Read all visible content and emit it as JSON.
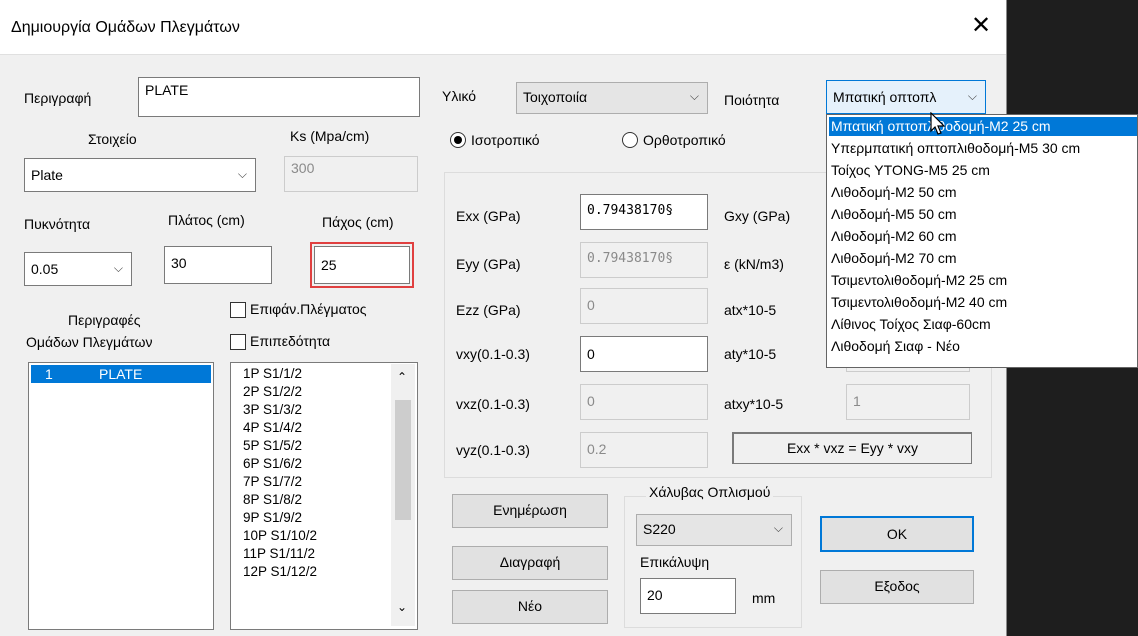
{
  "window": {
    "title": "Δημιουργία Ομάδων Πλεγμάτων",
    "close_glyph": "✕"
  },
  "description": {
    "label": "Περιγραφή",
    "value": "PLATE"
  },
  "element": {
    "label": "Στοιχείο",
    "selected": "Plate"
  },
  "ks": {
    "label": "Ks (Mpa/cm)",
    "value": "300"
  },
  "density": {
    "label": "Πυκνότητα",
    "selected": "0.05"
  },
  "width": {
    "label": "Πλάτος (cm)",
    "value": "30"
  },
  "thickness": {
    "label": "Πάχος (cm)",
    "value": "25"
  },
  "groups": {
    "label_line1": "Περιγραφές",
    "label_line2": "Ομάδων Πλεγμάτων",
    "items": [
      {
        "num": "1",
        "name": "PLATE"
      }
    ]
  },
  "checkboxes": {
    "mesh_surface": "Επιφάν.Πλέγματος",
    "planarity": "Επιπεδότητα"
  },
  "strips": [
    "1P S1/1/2",
    "2P S1/2/2",
    "3P S1/3/2",
    "4P S1/4/2",
    "5P S1/5/2",
    "6P S1/6/2",
    "7P S1/7/2",
    "8P S1/8/2",
    "9P S1/9/2",
    "10P S1/10/2",
    "11P S1/11/2",
    "12P S1/12/2"
  ],
  "material": {
    "label": "Υλικό",
    "selected": "Τοιχοποιία"
  },
  "quality": {
    "label": "Ποιότητα",
    "selected": "Μπατική οπτοπλ",
    "options": [
      "Μπατική οπτοπλιθοδομή-Μ2 25 cm",
      "Υπερμπατική οπτοπλιθοδομή-Μ5 30 cm",
      "Τοίχος YTONG-M5 25 cm",
      "Λιθοδομή-Μ2 50 cm",
      "Λιθοδομή-Μ5 50 cm",
      "Λιθοδομή-Μ2 60 cm",
      "Λιθοδομή-Μ2 70 cm",
      "Τσιμεντολιθοδομή-Μ2 25 cm",
      "Τσιμεντολιθοδομή-Μ2 40 cm",
      "Λίθινος Τοίχος Σιαφ-60cm",
      "Λιθοδομή Σιαφ - Νέο"
    ]
  },
  "isotropy": {
    "isotropic": "Ισοτροπικό",
    "orthotropic": "Ορθοτροπικό",
    "selected": "isotropic"
  },
  "props": {
    "exx": {
      "label": "Exx (GPa)",
      "value": "0.79438170§"
    },
    "eyy": {
      "label": "Eyy (GPa)",
      "value": "0.79438170§"
    },
    "ezz": {
      "label": "Ezz (GPa)",
      "value": "0"
    },
    "vxy": {
      "label": "vxy(0.1-0.3)",
      "value": "0"
    },
    "vxz": {
      "label": "vxz(0.1-0.3)",
      "value": "0"
    },
    "vyz": {
      "label": "vyz(0.1-0.3)",
      "value": "0.2"
    },
    "gxy": {
      "label": "Gxy (GPa)"
    },
    "eps": {
      "label": "ε (kN/m3)"
    },
    "atx": {
      "label": "atx*10-5"
    },
    "aty": {
      "label": "aty*10-5"
    },
    "atxy": {
      "label": "atxy*10-5",
      "value": "1"
    },
    "formula": "Exx * vxz = Eyy * vxy"
  },
  "steel": {
    "label": "Χάλυβας Οπλισμού",
    "selected": "S220",
    "cover_label": "Επικάλυψη",
    "cover_value": "20",
    "unit": "mm"
  },
  "buttons": {
    "update": "Ενημέρωση",
    "delete": "Διαγραφή",
    "new": "Νέο",
    "ok": "OK",
    "exit": "Εξοδος"
  }
}
